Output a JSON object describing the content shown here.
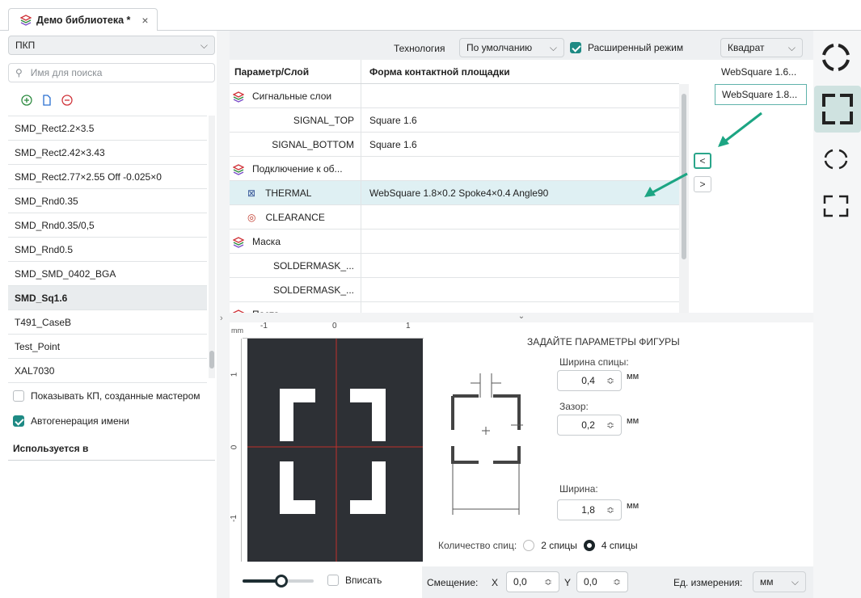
{
  "tab": {
    "title": "Демо библиотека *",
    "close": "×"
  },
  "left": {
    "category": "ПКП",
    "search_placeholder": "Имя для поиска",
    "items": [
      "SMD_Rect2.2×3.5",
      "SMD_Rect2.42×3.43",
      "SMD_Rect2.77×2.55 Off -0.025×0",
      "SMD_Rnd0.35",
      "SMD_Rnd0.35/0,5",
      "SMD_Rnd0.5",
      "SMD_SMD_0402_BGA",
      "SMD_Sq1.6",
      "T491_CaseB",
      "Test_Point",
      "XAL7030"
    ],
    "selected_index": 7,
    "show_wizard": "Показывать КП, созданные мастером",
    "autogen": "Автогенерация имени",
    "used_in": "Используется в"
  },
  "top": {
    "tech_label": "Технология",
    "tech_value": "По умолчанию",
    "advanced": "Расширенный режим",
    "shape_value": "Квадрат"
  },
  "table": {
    "col1": "Параметр/Слой",
    "col2": "Форма контактной площадки",
    "rows": [
      {
        "name": "Сигнальные слои",
        "value": "",
        "group": true
      },
      {
        "name": "SIGNAL_TOP",
        "value": "Square 1.6"
      },
      {
        "name": "SIGNAL_BOTTOM",
        "value": "Square 1.6"
      },
      {
        "name": "Подключение к об...",
        "value": "",
        "group": true
      },
      {
        "name": "THERMAL",
        "value": "WebSquare 1.8×0.2 Spoke4×0.4 Angle90"
      },
      {
        "name": "CLEARANCE",
        "value": ""
      },
      {
        "name": "Маска",
        "value": "",
        "group": true
      },
      {
        "name": "SOLDERMASK_...",
        "value": ""
      },
      {
        "name": "SOLDERMASK_...",
        "value": ""
      },
      {
        "name": "Паста",
        "value": "",
        "group": true
      }
    ]
  },
  "variants": [
    "WebSquare 1.6...",
    "WebSquare 1.8..."
  ],
  "ruler": {
    "unit": "mm",
    "top": [
      "-1",
      "0",
      "1"
    ],
    "left": [
      "1",
      "0",
      "-1"
    ]
  },
  "params": {
    "title": "ЗАДАЙТЕ ПАРАМЕТРЫ ФИГУРЫ",
    "spoke_width_label": "Ширина спицы:",
    "spoke_width": "0,4",
    "gap_label": "Зазор:",
    "gap": "0,2",
    "width_label": "Ширина:",
    "width": "1,8",
    "unit": "мм",
    "spokes_label": "Количество спиц:",
    "spokes2": "2 спицы",
    "spokes4": "4 спицы"
  },
  "bottom": {
    "fit": "Вписать",
    "offset_label": "Смещение:",
    "x_label": "X",
    "x": "0,0",
    "y_label": "Y",
    "y": "0,0",
    "units_label": "Ед. измерения:",
    "units": "мм"
  },
  "zoom_level": 0.55,
  "nav": {
    "left": "<",
    "right": ">"
  },
  "accent": "#1e8a84"
}
